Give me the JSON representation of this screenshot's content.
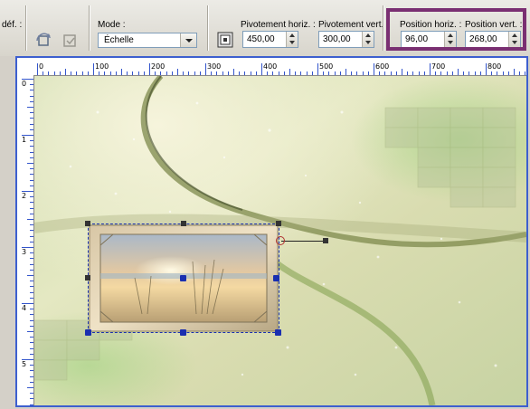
{
  "toolbar": {
    "cut_label": "déf. :",
    "mode": {
      "label": "Mode :",
      "value": "Échelle"
    },
    "pivot_h": {
      "label": "Pivotement horiz. :",
      "value": "450,00"
    },
    "pivot_v": {
      "label": "Pivotement vert. :",
      "value": "300,00"
    },
    "pos_h": {
      "label": "Position horiz. :",
      "value": "96,00"
    },
    "pos_v": {
      "label": "Position vert. :",
      "value": "268,00"
    }
  },
  "ruler": {
    "h_labels": [
      "0",
      "100",
      "200",
      "300",
      "400",
      "500",
      "600",
      "700",
      "800"
    ],
    "v_labels": [
      "0",
      "1",
      "2",
      "3",
      "4",
      "5"
    ]
  },
  "colors": {
    "highlight": "#7a2f72",
    "ruler_ticks": "#3355cc",
    "frame": "#3d5fcf"
  }
}
